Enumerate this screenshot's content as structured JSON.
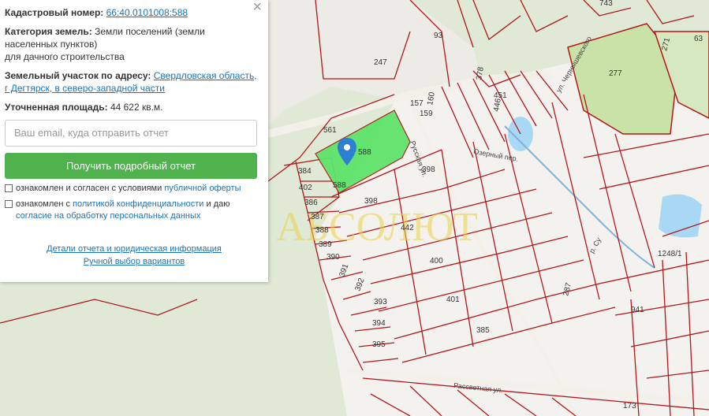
{
  "panel": {
    "cadastral_label": "Кадастровый номер:",
    "cadastral_value": "66:40.0101008:588",
    "category_label": "Категория земель:",
    "category_value_1": "Земли поселений (земли",
    "category_value_2": "населенных пунктов)",
    "category_value_3": "для дачного строительства",
    "address_label": "Земельный участок по адресу:",
    "address_value_1": "Свердловская область,",
    "address_value_2": "г Дегтярск, в северо-западной части",
    "area_label": "Уточненная площадь:",
    "area_value": "44 622 кв.м.",
    "email_placeholder": "Ваш email, куда отправить отчет",
    "submit_label": "Получить подробный отчет",
    "consent1_prefix": "ознакомлен и согласен с условиями ",
    "consent1_link": "публичной оферты",
    "consent2_prefix": "ознакомлен с ",
    "consent2_link": "политикой конфиденциальности",
    "consent2_mid": " и даю",
    "consent2_link2": "согласие на обработку персональных данных",
    "details_link": "Детали отчета и юридическая информация",
    "manual_link": "Ручной выбор вариантов",
    "close_symbol": "×"
  },
  "map": {
    "watermark": "АБСОЛЮТ",
    "plots": [
      "588",
      "588",
      "588",
      "561",
      "247",
      "93",
      "743",
      "63",
      "271",
      "277",
      "378",
      "451",
      "446",
      "157",
      "159",
      "160",
      "384",
      "402",
      "386",
      "387",
      "388",
      "389",
      "390",
      "391",
      "392",
      "393",
      "394",
      "395",
      "398",
      "398",
      "442",
      "400",
      "401",
      "385",
      "287",
      "1248/1",
      "941",
      "173"
    ],
    "streets": [
      "Русская ул.",
      "ул. Чернышевского",
      "Рассветная ул.",
      "р. Су",
      "Озерный пер."
    ],
    "colors": {
      "background": "#dfe9d6",
      "parcel_line": "#b3161b",
      "selected_plot": "#5fe36a",
      "water": "#a9d8f5",
      "road": "#f3f0ea",
      "marker": "#2d7fd1",
      "button": "#4fb24d",
      "link": "#1a73b6"
    }
  }
}
